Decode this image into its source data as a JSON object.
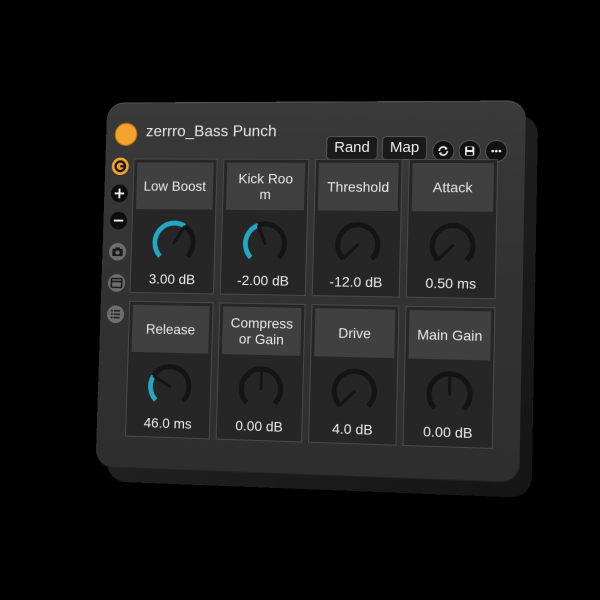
{
  "device": {
    "title": "zerrro_Bass Punch",
    "buttons": {
      "rand": "Rand",
      "map": "Map"
    },
    "icons": [
      "refresh-icon",
      "save-icon",
      "more-icon"
    ]
  },
  "sidebar": [
    "orange-logo-icon",
    "plus-icon",
    "minus-icon",
    "camera-icon",
    "window-icon",
    "list-icon"
  ],
  "colors": {
    "accent": "#24a6c4",
    "power": "#f4a32e",
    "knob_ring": "#141414"
  },
  "knobs": [
    {
      "label": "Low Boost",
      "value": "3.00 dB",
      "level": 0.62
    },
    {
      "label": "Kick Room",
      "value": "-2.00 dB",
      "level": 0.42
    },
    {
      "label": "Threshold",
      "value": "-12.0 dB",
      "level": 0.0
    },
    {
      "label": "Attack",
      "value": "0.50 ms",
      "level": 0.0
    },
    {
      "label": "Release",
      "value": "46.0 ms",
      "level": 0.28
    },
    {
      "label": "Compressor Gain",
      "value": "0.00 dB",
      "level": 0.5
    },
    {
      "label": "Drive",
      "value": "4.0 dB",
      "level": 0.0
    },
    {
      "label": "Main Gain",
      "value": "0.00 dB",
      "level": 0.5
    }
  ]
}
